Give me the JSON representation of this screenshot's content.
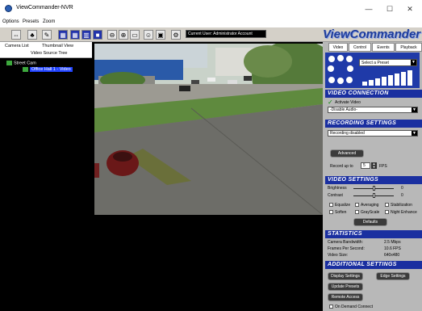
{
  "window": {
    "title": "ViewCommander-NVR",
    "minimize": "—",
    "maximize": "☐",
    "close": "✕"
  },
  "menu": [
    "Options",
    "Presets",
    "Zoom"
  ],
  "toolbar": {
    "current_user": "Current User: Administrator Account"
  },
  "brand": "ViewCommander",
  "left_tabs": {
    "camera_list": "Camera List",
    "thumbnail_view": "Thumbnail View",
    "video_source_tree": "Video Source Tree"
  },
  "tree": {
    "root": "Street Cam",
    "child": "Office Hall 1 - Video"
  },
  "right_tabs": [
    "Video",
    "Control",
    "Events",
    "Playback"
  ],
  "ptz": {
    "preset_placeholder": "Select a Preset"
  },
  "video_connection": {
    "header": "VIDEO CONNECTION",
    "activate_label": "Activate Video",
    "audio_value": "-Disable Audio-"
  },
  "recording": {
    "header": "RECORDING SETTINGS",
    "mode_value": "Recording disabled",
    "advanced_label": "Advanced",
    "record_up_to_label": "Record up to",
    "fps_value": "5",
    "fps_unit": "FPS"
  },
  "video_settings": {
    "header": "VIDEO SETTINGS",
    "brightness_label": "Brightness",
    "brightness_value": "0",
    "brightness_level": 0.5,
    "contrast_label": "Contrast",
    "contrast_value": "0",
    "contrast_level": 0.5,
    "checks": [
      "Equalize",
      "Averaging",
      "Stabilization",
      "Soften",
      "GrayScale",
      "Night Enhance"
    ],
    "defaults_label": "Defaults"
  },
  "statistics": {
    "header": "STATISTICS",
    "rows": [
      {
        "label": "Camera Bandwidth:",
        "value": "2.5 Mbps"
      },
      {
        "label": "Frames Per Second:",
        "value": "10.6 FPS"
      },
      {
        "label": "Video Size:",
        "value": "640x480"
      }
    ]
  },
  "additional": {
    "header": "ADDITIONAL SETTINGS",
    "display_settings": "Display Settings",
    "edge_settings": "Edge Settings",
    "update_presets": "Update Presets",
    "remote_access": "Remote Access",
    "on_demand": "On Demand Connect"
  },
  "colors": {
    "accent_blue": "#1a2fa0",
    "brand_blue": "#1e3c9a",
    "tree_bg": "#000000"
  }
}
